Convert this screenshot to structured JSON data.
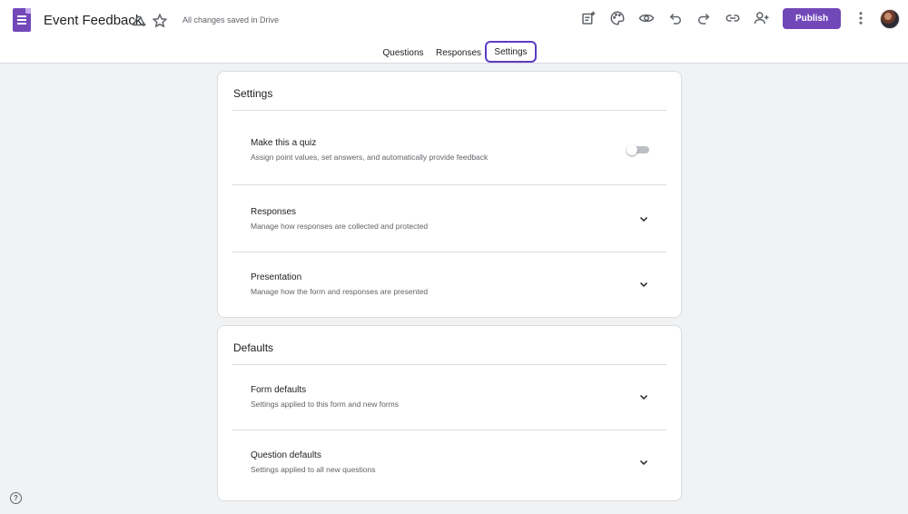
{
  "header": {
    "title": "Event Feedback",
    "save_status": "All changes saved in Drive",
    "publish_label": "Publish",
    "icons": [
      "forms-logo-icon",
      "move-to-drive-icon",
      "star-icon",
      "add-on-icon",
      "palette-icon",
      "preview-eye-icon",
      "undo-icon",
      "redo-icon",
      "link-icon",
      "add-collaborator-icon",
      "more-vert-icon"
    ]
  },
  "tabs": [
    {
      "label": "Questions",
      "active": false
    },
    {
      "label": "Responses",
      "active": false
    },
    {
      "label": "Settings",
      "active": true
    }
  ],
  "settings_card": {
    "title": "Settings",
    "rows": [
      {
        "title": "Make this a quiz",
        "subtitle": "Assign point values, set answers, and automatically provide feedback",
        "control": "toggle",
        "toggle_on": false
      },
      {
        "title": "Responses",
        "subtitle": "Manage how responses are collected and protected",
        "control": "expand"
      },
      {
        "title": "Presentation",
        "subtitle": "Manage how the form and responses are presented",
        "control": "expand"
      }
    ]
  },
  "defaults_card": {
    "title": "Defaults",
    "rows": [
      {
        "title": "Form defaults",
        "subtitle": "Settings applied to this form and new forms",
        "control": "expand"
      },
      {
        "title": "Question defaults",
        "subtitle": "Settings applied to all new questions",
        "control": "expand"
      }
    ]
  },
  "help": {
    "glyph": "?"
  },
  "colors": {
    "accent": "#7248b9",
    "tab_focus": "#5b3cc4",
    "background": "#f0f2f3"
  }
}
